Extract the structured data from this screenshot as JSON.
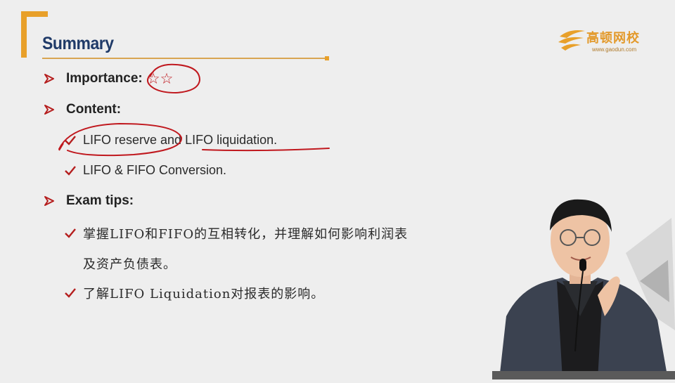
{
  "slide": {
    "title": "Summary",
    "logo": {
      "name_cn": "高顿网校",
      "url": "www.gaodun.com"
    },
    "importance": {
      "label": "Importance:",
      "stars": "☆☆"
    },
    "content": {
      "label": "Content:",
      "items": [
        "LIFO reserve and LIFO liquidation.",
        "LIFO & FIFO Conversion."
      ]
    },
    "exam_tips": {
      "label": "Exam tips:",
      "item1_line1": "掌握LIFO和FIFO的互相转化，并理解如何影响利润表",
      "item1_line2": "及资产负债表。",
      "item2": "了解LIFO Liquidation对报表的影响。"
    }
  },
  "colors": {
    "title": "#1f3a68",
    "accent": "#e8a02a",
    "bullet": "#b51e1e",
    "annotation": "#c0181e"
  },
  "icons": [
    "arrow-bullet-icon",
    "check-icon",
    "gaodun-logo-icon"
  ]
}
